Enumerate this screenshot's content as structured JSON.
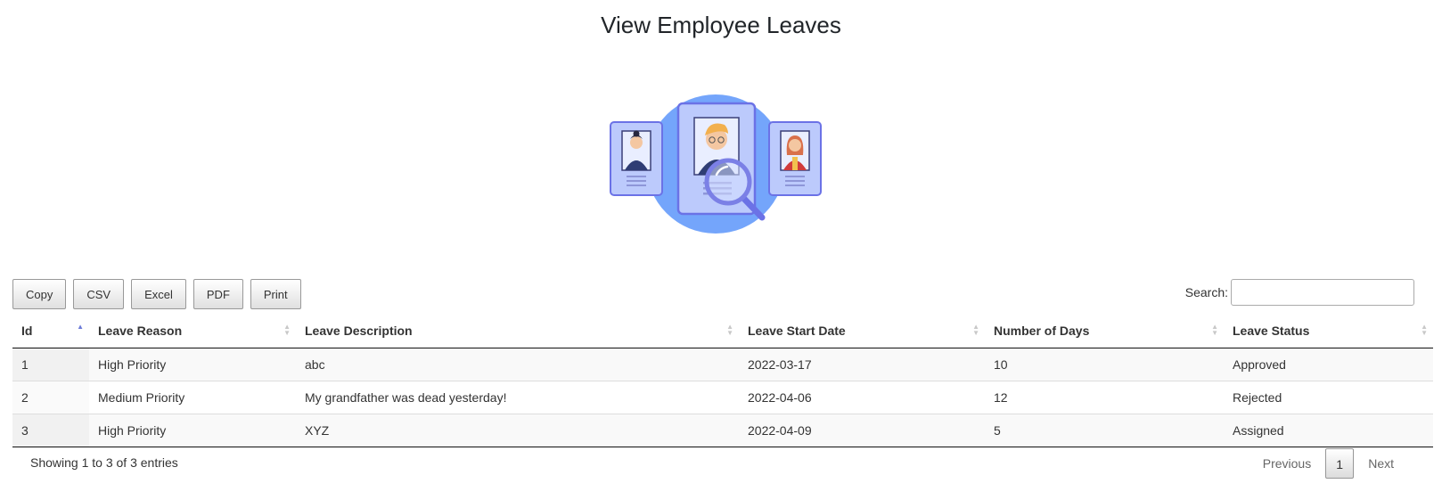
{
  "page": {
    "title": "View Employee Leaves"
  },
  "toolbar": {
    "buttons": [
      "Copy",
      "CSV",
      "Excel",
      "PDF",
      "Print"
    ]
  },
  "search": {
    "label": "Search:",
    "value": "",
    "placeholder": ""
  },
  "table": {
    "columns": [
      "Id",
      "Leave Reason",
      "Leave Description",
      "Leave Start Date",
      "Number of Days",
      "Leave Status"
    ],
    "sorted_column": "Id",
    "sort_direction": "ascending",
    "rows": [
      [
        "1",
        "High Priority",
        "abc",
        "2022-03-17",
        "10",
        "Approved"
      ],
      [
        "2",
        "Medium Priority",
        "My grandfather was dead yesterday!",
        "2022-04-06",
        "12",
        "Rejected"
      ],
      [
        "3",
        "High Priority",
        "XYZ",
        "2022-04-09",
        "5",
        "Assigned"
      ]
    ]
  },
  "footer": {
    "info": "Showing 1 to 3 of 3 entries"
  },
  "pagination": {
    "previous": "Previous",
    "current": "1",
    "next": "Next"
  },
  "colors": {
    "accent": "#6c7bd8",
    "illustration_circle": "#74a5fb",
    "card_fill": "#bccafc",
    "card_border": "#6b72e6"
  }
}
